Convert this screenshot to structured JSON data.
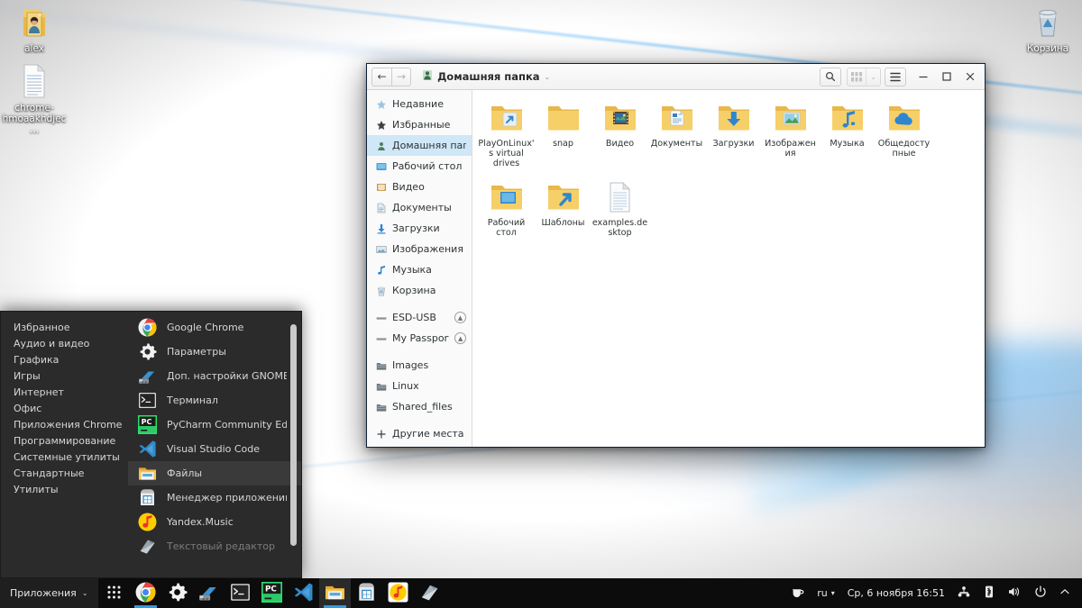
{
  "desktop": {
    "icons": [
      {
        "name": "alex",
        "label": "alex",
        "type": "home-folder"
      },
      {
        "name": "chrome-file",
        "label": "chrome-hmoaakhdjec…",
        "type": "text-file"
      },
      {
        "name": "trash",
        "label": "Корзина",
        "type": "trash"
      }
    ]
  },
  "file_manager": {
    "nav": {
      "back": "←",
      "forward": "→"
    },
    "path_label": "Домашняя папка",
    "path_chevron": "⌄",
    "titlebar_buttons": {
      "search": "search-icon",
      "view_grid": "grid-view-icon",
      "view_chevron": "⌄",
      "menu": "hamburger-icon",
      "minimize": "—",
      "maximize": "□",
      "close": "✕"
    },
    "sidebar": [
      {
        "label": "Недавние",
        "icon": "recent-icon",
        "selected": false
      },
      {
        "label": "Избранные",
        "icon": "star-icon",
        "selected": false
      },
      {
        "label": "Домашняя папка",
        "icon": "home-icon",
        "selected": true
      },
      {
        "label": "Рабочий стол",
        "icon": "desktop-icon",
        "selected": false
      },
      {
        "label": "Видео",
        "icon": "video-icon",
        "selected": false
      },
      {
        "label": "Документы",
        "icon": "documents-icon",
        "selected": false
      },
      {
        "label": "Загрузки",
        "icon": "downloads-icon",
        "selected": false
      },
      {
        "label": "Изображения",
        "icon": "pictures-icon",
        "selected": false
      },
      {
        "label": "Музыка",
        "icon": "music-icon",
        "selected": false
      },
      {
        "label": "Корзина",
        "icon": "trash-icon",
        "selected": false
      },
      {
        "separator": true
      },
      {
        "label": "ESD-USB",
        "icon": "drive-icon",
        "eject": true,
        "selected": false
      },
      {
        "label": "My Passport",
        "icon": "drive-icon",
        "eject": true,
        "selected": false
      },
      {
        "separator": true
      },
      {
        "label": "Images",
        "icon": "network-folder-icon",
        "selected": false
      },
      {
        "label": "Linux",
        "icon": "network-folder-icon",
        "selected": false
      },
      {
        "label": "Shared_files",
        "icon": "network-folder-icon",
        "selected": false
      },
      {
        "separator": true
      },
      {
        "label": "Другие места",
        "icon": "plus-icon",
        "selected": false
      }
    ],
    "files": [
      {
        "label": "PlayOnLinux's virtual drives",
        "icon": "folder-link-icon"
      },
      {
        "label": "snap",
        "icon": "folder-icon"
      },
      {
        "label": "Видео",
        "icon": "folder-video-icon"
      },
      {
        "label": "Документы",
        "icon": "folder-documents-icon"
      },
      {
        "label": "Загрузки",
        "icon": "folder-downloads-icon"
      },
      {
        "label": "Изображения",
        "icon": "folder-pictures-icon"
      },
      {
        "label": "Музыка",
        "icon": "folder-music-icon"
      },
      {
        "label": "Общедоступные",
        "icon": "folder-public-icon"
      },
      {
        "label": "Рабочий стол",
        "icon": "folder-desktop-icon"
      },
      {
        "label": "Шаблоны",
        "icon": "folder-link-icon"
      },
      {
        "label": "examples.desktop",
        "icon": "text-file-icon"
      }
    ]
  },
  "app_menu": {
    "categories": [
      "Избранное",
      "Аудио и видео",
      "Графика",
      "Игры",
      "Интернет",
      "Офис",
      "Приложения Chrome",
      "Программирование",
      "Системные утилиты",
      "Стандартные",
      "Утилиты"
    ],
    "apps": [
      {
        "label": "Google Chrome",
        "icon": "chrome-icon",
        "highlighted": false,
        "dimmed": false
      },
      {
        "label": "Параметры",
        "icon": "settings-gear-icon",
        "highlighted": false,
        "dimmed": false
      },
      {
        "label": "Доп. настройки GNOME",
        "icon": "gnome-tweaks-icon",
        "highlighted": false,
        "dimmed": false
      },
      {
        "label": "Терминал",
        "icon": "terminal-icon",
        "highlighted": false,
        "dimmed": false
      },
      {
        "label": "PyCharm Community Edit…",
        "icon": "pycharm-icon",
        "highlighted": false,
        "dimmed": false
      },
      {
        "label": "Visual Studio Code",
        "icon": "vscode-icon",
        "highlighted": false,
        "dimmed": false
      },
      {
        "label": "Файлы",
        "icon": "files-icon",
        "highlighted": true,
        "dimmed": false
      },
      {
        "label": "Менеджер приложений…",
        "icon": "app-manager-icon",
        "highlighted": false,
        "dimmed": false
      },
      {
        "label": "Yandex.Music",
        "icon": "yandex-music-icon",
        "highlighted": false,
        "dimmed": false
      },
      {
        "label": "Текстовый редактор",
        "icon": "text-editor-icon",
        "highlighted": false,
        "dimmed": true
      }
    ]
  },
  "taskbar": {
    "apps_button": {
      "label": "Приложения",
      "chevron": "⌄"
    },
    "launchers": [
      {
        "name": "app-grid",
        "icon": "grid-dots-icon",
        "running": false,
        "active": false
      },
      {
        "name": "chrome",
        "icon": "chrome-icon",
        "running": true,
        "active": false
      },
      {
        "name": "settings",
        "icon": "settings-gear-icon",
        "running": false,
        "active": false
      },
      {
        "name": "gnome-tweaks",
        "icon": "gnome-tweaks-icon",
        "running": false,
        "active": false
      },
      {
        "name": "terminal",
        "icon": "terminal-icon",
        "running": false,
        "active": false
      },
      {
        "name": "pycharm",
        "icon": "pycharm-icon",
        "running": false,
        "active": false
      },
      {
        "name": "vscode",
        "icon": "vscode-icon",
        "running": false,
        "active": false
      },
      {
        "name": "files",
        "icon": "files-icon",
        "running": true,
        "active": true
      },
      {
        "name": "app-manager",
        "icon": "app-manager-icon",
        "running": false,
        "active": false
      },
      {
        "name": "yandex-music",
        "icon": "yandex-music-icon",
        "running": false,
        "active": false
      },
      {
        "name": "text-editor",
        "icon": "text-editor-icon",
        "running": false,
        "active": false
      }
    ],
    "tray": {
      "coffee": "coffee-icon",
      "language": "ru",
      "language_chevron": "▾",
      "clock": "Ср, 6 ноября  16:51",
      "network": "network-icon",
      "bluetooth": "bluetooth-icon",
      "volume": "volume-icon",
      "power": "power-icon",
      "expand": "chevron-up-icon"
    }
  },
  "colors": {
    "accent": "#3399e0",
    "selection": "#cfe7f7",
    "taskbar_bg": "#0c0c0c",
    "menu_bg": "#2b2b2b",
    "folder": "#f5c council"
  }
}
